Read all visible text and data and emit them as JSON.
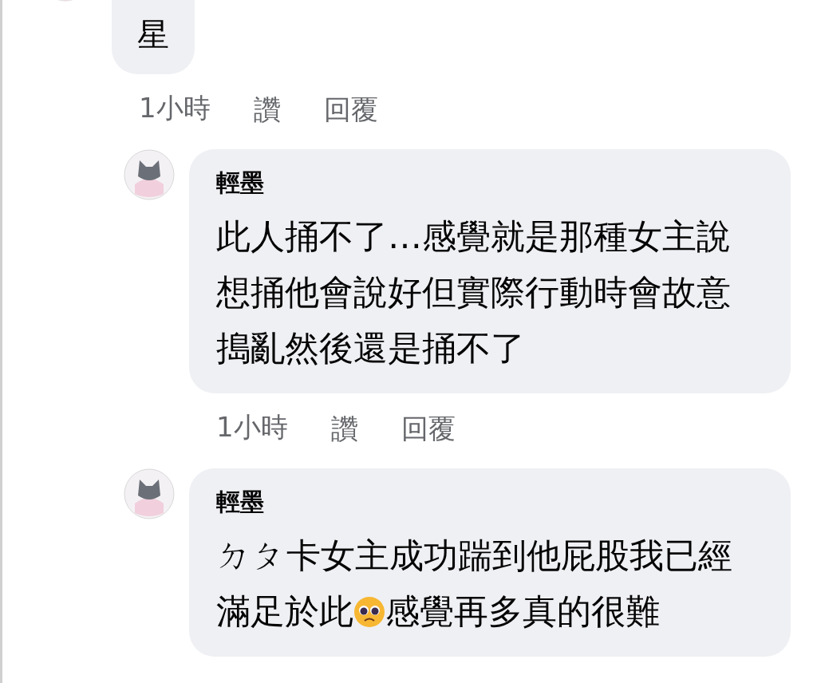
{
  "comment": {
    "body": [
      {
        "kind": "text",
        "text": "星"
      }
    ],
    "time": "1小時",
    "like": "讚",
    "reply": "回覆"
  },
  "replies": [
    {
      "author": "輕墨",
      "body": [
        {
          "kind": "text",
          "text": "此人捅不了…感覺就是那種女主說想捅他會說好但實際行動時會故意搗亂然後還是捅不了"
        }
      ],
      "time": "1小時",
      "like": "讚",
      "reply": "回覆"
    },
    {
      "author": "輕墨",
      "body": [
        {
          "kind": "text",
          "text": "ㄉㄆ卡女主成功踹到他屁股我已經滿足於此"
        },
        {
          "kind": "emoji"
        },
        {
          "kind": "text",
          "text": "感覺再多真的很難"
        }
      ]
    }
  ]
}
